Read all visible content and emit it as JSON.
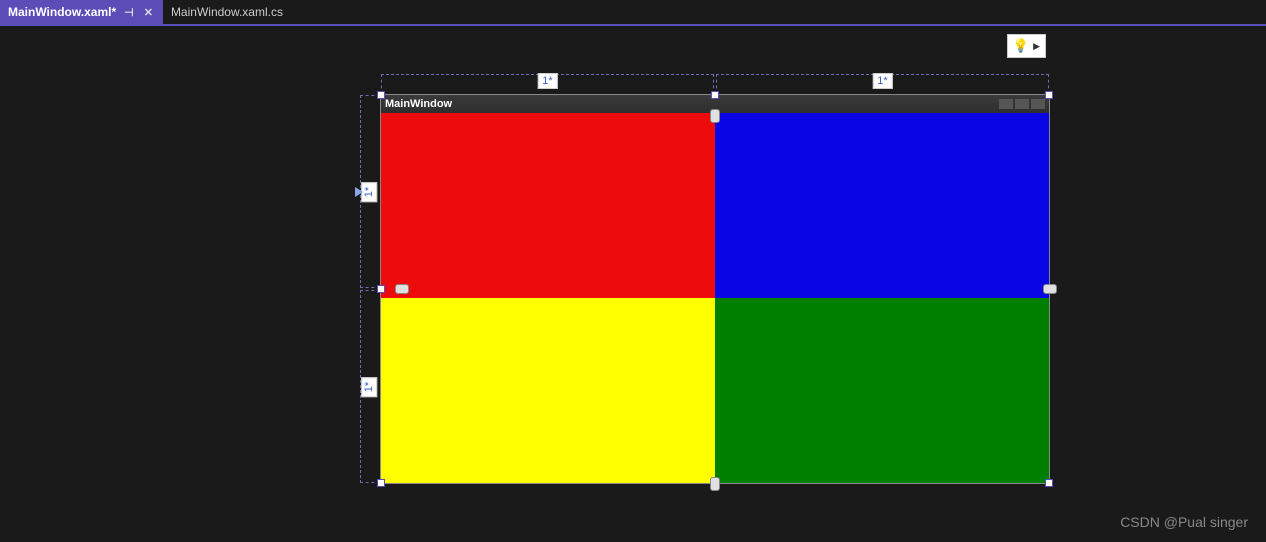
{
  "tabs": {
    "active": {
      "label": "MainWindow.xaml*"
    },
    "inactive": {
      "label": "MainWindow.xaml.cs"
    }
  },
  "designer": {
    "window_title": "MainWindow",
    "columns": [
      {
        "size": "1*"
      },
      {
        "size": "1*"
      }
    ],
    "rows": [
      {
        "size": "1*"
      },
      {
        "size": "1*"
      }
    ],
    "cells": [
      {
        "row": 0,
        "col": 0,
        "color": "#ee0b0b"
      },
      {
        "row": 0,
        "col": 1,
        "color": "#0a05e5"
      },
      {
        "row": 1,
        "col": 0,
        "color": "#ffff00"
      },
      {
        "row": 1,
        "col": 1,
        "color": "#008000"
      }
    ]
  },
  "watermark": "CSDN @Pual singer"
}
